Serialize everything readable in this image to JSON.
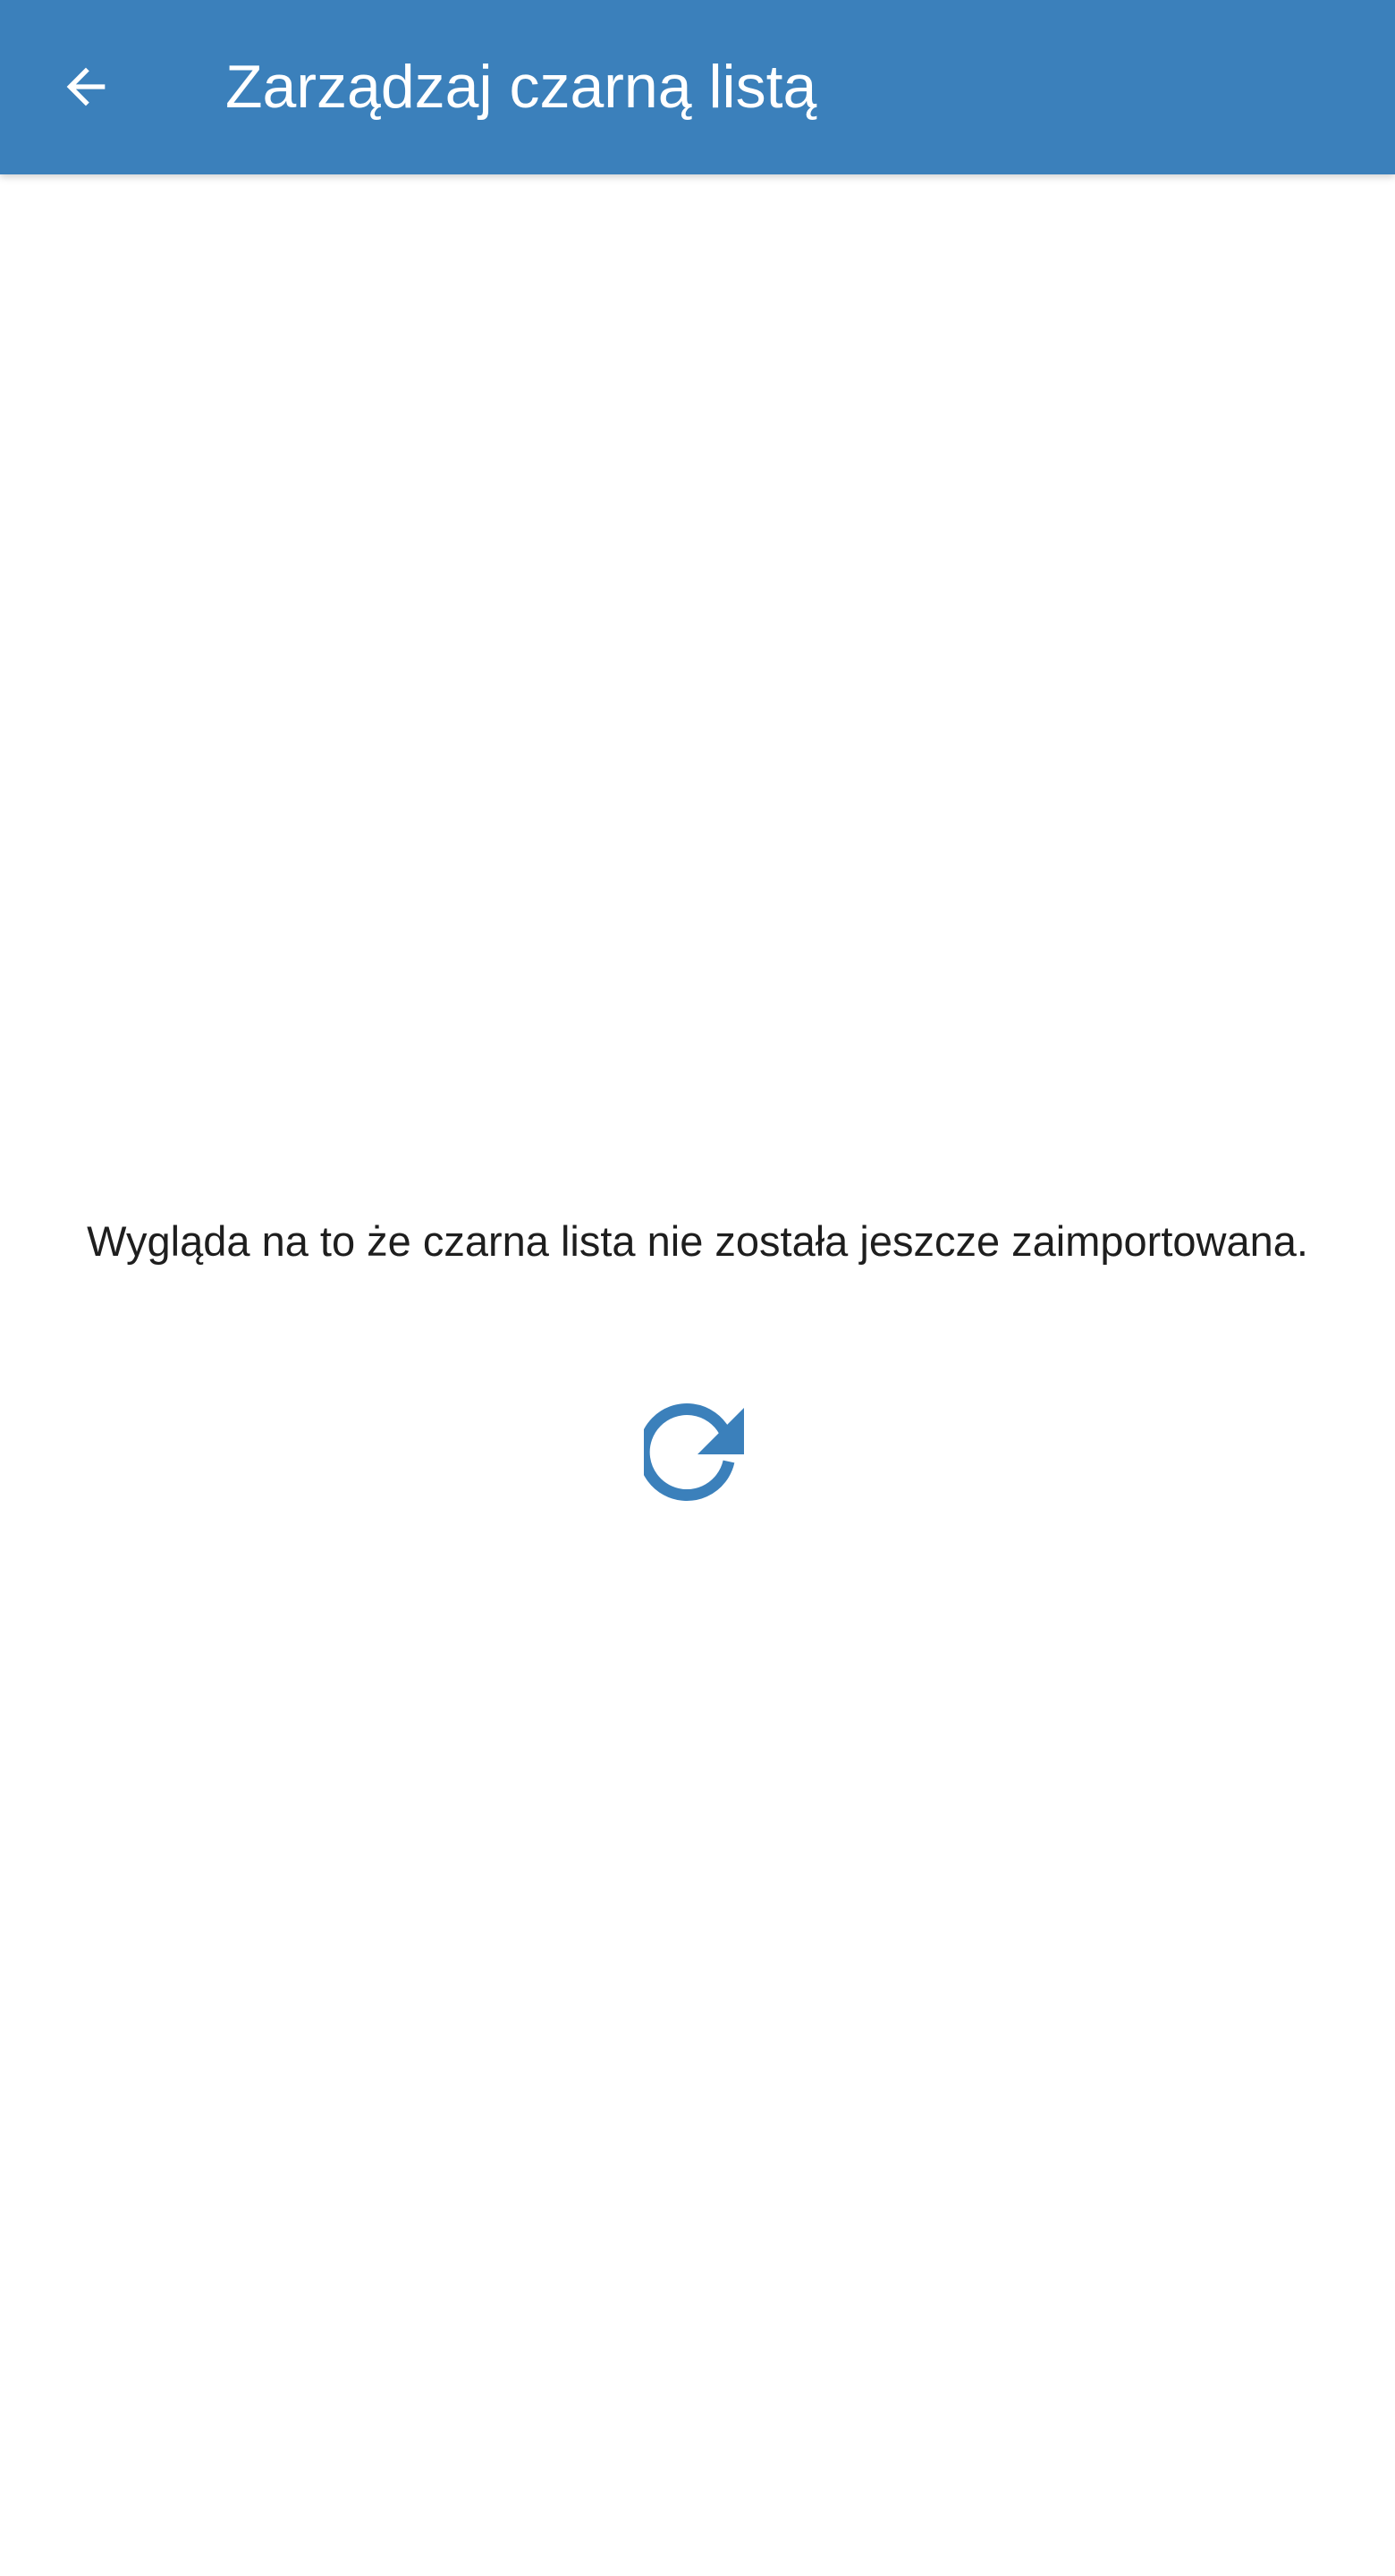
{
  "toolbar": {
    "title": "Zarządzaj czarną listą",
    "back_icon": "arrow-back-icon",
    "background_color": "#3b80bb",
    "foreground_color": "#ffffff"
  },
  "main": {
    "empty_message": "Wygląda na to że czarna lista nie została jeszcze zaimportowana.",
    "refresh_icon": "refresh-icon",
    "accent_color": "#3b80bb"
  }
}
